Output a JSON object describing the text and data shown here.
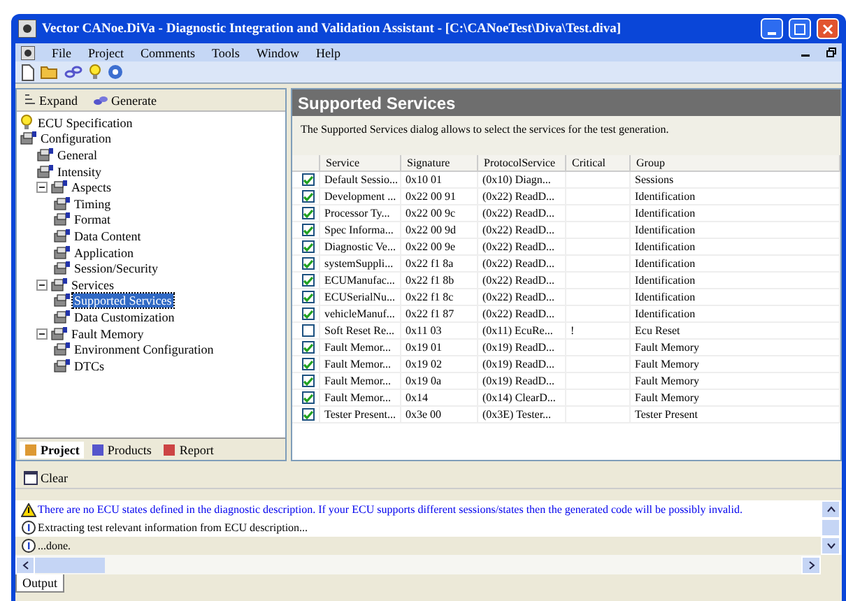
{
  "window": {
    "title": "Vector CANoe.DiVa - Diagnostic Integration and Validation Assistant - [C:\\CANoeTest\\Diva\\Test.diva]"
  },
  "menu": [
    "File",
    "Project",
    "Comments",
    "Tools",
    "Window",
    "Help"
  ],
  "sidebar": {
    "toolbar": [
      "Expand",
      "Generate"
    ],
    "tree": [
      {
        "label": "ECU Specification",
        "kind": "bulb",
        "selected": false
      },
      {
        "label": "Configuration",
        "kind": "folder",
        "selected": false,
        "children": [
          {
            "label": "General",
            "kind": "folder",
            "selected": false
          },
          {
            "label": "Intensity",
            "kind": "folder",
            "selected": false
          },
          {
            "label": "Aspects",
            "kind": "folder",
            "selected": false,
            "expanded": true,
            "children": [
              {
                "label": "Timing",
                "kind": "folder",
                "selected": false
              },
              {
                "label": "Format",
                "kind": "folder",
                "selected": false
              },
              {
                "label": "Data Content",
                "kind": "folder",
                "selected": false
              },
              {
                "label": "Application",
                "kind": "folder",
                "selected": false
              },
              {
                "label": "Session/Security",
                "kind": "folder",
                "selected": false
              }
            ]
          },
          {
            "label": "Services",
            "kind": "folder",
            "selected": false,
            "expanded": true,
            "children": [
              {
                "label": "Supported Services",
                "kind": "folder",
                "selected": true
              },
              {
                "label": "Data Customization",
                "kind": "folder",
                "selected": false
              }
            ]
          },
          {
            "label": "Fault Memory",
            "kind": "folder",
            "selected": false,
            "expanded": true,
            "children": [
              {
                "label": "Environment Configuration",
                "kind": "folder",
                "selected": false
              },
              {
                "label": "DTCs",
                "kind": "folder",
                "selected": false
              }
            ]
          }
        ]
      }
    ],
    "tabs": [
      {
        "label": "Project",
        "selected": true
      },
      {
        "label": "Products",
        "selected": false
      },
      {
        "label": "Report",
        "selected": false
      }
    ]
  },
  "panel": {
    "title": "Supported Services",
    "description": "The Supported Services dialog allows to select the services for the test generation.",
    "columns": [
      "Service",
      "Signature",
      "ProtocolService",
      "Critical",
      "Group"
    ],
    "rows": [
      {
        "checked": true,
        "service": "Default Sessio...",
        "signature": "0x10 01",
        "protocol": "(0x10) Diagn...",
        "group": "Sessions"
      },
      {
        "checked": true,
        "service": "Development ...",
        "signature": "0x22 00 91",
        "protocol": "(0x22) ReadD...",
        "group": "Identification"
      },
      {
        "checked": true,
        "service": "Processor Ty...",
        "signature": "0x22 00 9c",
        "protocol": "(0x22) ReadD...",
        "group": "Identification"
      },
      {
        "checked": true,
        "service": "Spec Informa...",
        "signature": "0x22 00 9d",
        "protocol": "(0x22) ReadD...",
        "group": "Identification"
      },
      {
        "checked": true,
        "service": "Diagnostic Ve...",
        "signature": "0x22 00 9e",
        "protocol": "(0x22) ReadD...",
        "group": "Identification"
      },
      {
        "checked": true,
        "service": "systemSuppli...",
        "signature": "0x22 f1 8a",
        "protocol": "(0x22) ReadD...",
        "group": "Identification"
      },
      {
        "checked": true,
        "service": "ECUManufac...",
        "signature": "0x22 f1 8b",
        "protocol": "(0x22) ReadD...",
        "group": "Identification"
      },
      {
        "checked": true,
        "service": "ECUSerialNu...",
        "signature": "0x22 f1 8c",
        "protocol": "(0x22) ReadD...",
        "group": "Identification"
      },
      {
        "checked": true,
        "service": "vehicleManuf...",
        "signature": "0x22 f1 87",
        "protocol": "(0x22) ReadD...",
        "group": "Identification"
      },
      {
        "checked": false,
        "service": "Soft Reset Re...",
        "signature": "0x11 03",
        "protocol": "(0x11) EcuRe...",
        "critical": "!",
        "group": "Ecu Reset"
      },
      {
        "checked": true,
        "service": "Fault Memor...",
        "signature": "0x19 01",
        "protocol": "(0x19) ReadD...",
        "group": "Fault Memory"
      },
      {
        "checked": true,
        "service": "Fault Memor...",
        "signature": "0x19 02",
        "protocol": "(0x19) ReadD...",
        "group": "Fault Memory"
      },
      {
        "checked": true,
        "service": "Fault Memor...",
        "signature": "0x19 0a",
        "protocol": "(0x19) ReadD...",
        "group": "Fault Memory"
      },
      {
        "checked": true,
        "service": "Fault Memor...",
        "signature": "0x14",
        "protocol": "(0x14) ClearD...",
        "group": "Fault Memory"
      },
      {
        "checked": true,
        "service": "Tester Present...",
        "signature": "0x3e 00",
        "protocol": "(0x3E) Tester...",
        "group": "Tester Present"
      }
    ]
  },
  "output": {
    "toolbar": [
      "Clear"
    ],
    "messages": [
      {
        "kind": "warning",
        "text": "There are no ECU states defined in the diagnostic description. If your ECU supports different sessions/states then the generated code will be possibly invalid."
      },
      {
        "kind": "info",
        "text": "Extracting test relevant information from ECU description..."
      },
      {
        "kind": "info",
        "text": "...done."
      }
    ],
    "tab": "Output"
  }
}
